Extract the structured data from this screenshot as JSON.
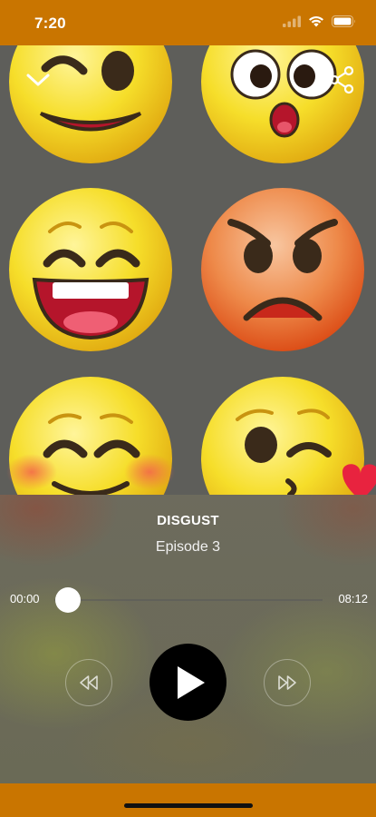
{
  "status_bar": {
    "time": "7:20",
    "signal_icon": "cellular-signal-icon",
    "wifi_icon": "wifi-icon",
    "battery_icon": "battery-icon"
  },
  "header": {
    "collapse_icon": "chevron-down-icon",
    "share_icon": "share-icon"
  },
  "artwork": {
    "description_icons": [
      "wink-emoji",
      "surprised-emoji",
      "laughing-emoji",
      "angry-emoji",
      "blushing-emoji",
      "kissing-emoji"
    ]
  },
  "track": {
    "title": "DISGUST",
    "subtitle": "Episode 3"
  },
  "progress": {
    "elapsed": "00:00",
    "total": "08:12",
    "fraction": 0.0
  },
  "controls": {
    "rewind_icon": "rewind-icon",
    "play_icon": "play-icon",
    "forward_icon": "fast-forward-icon"
  },
  "colors": {
    "accent": "#c97500",
    "play_button": "#000000"
  }
}
